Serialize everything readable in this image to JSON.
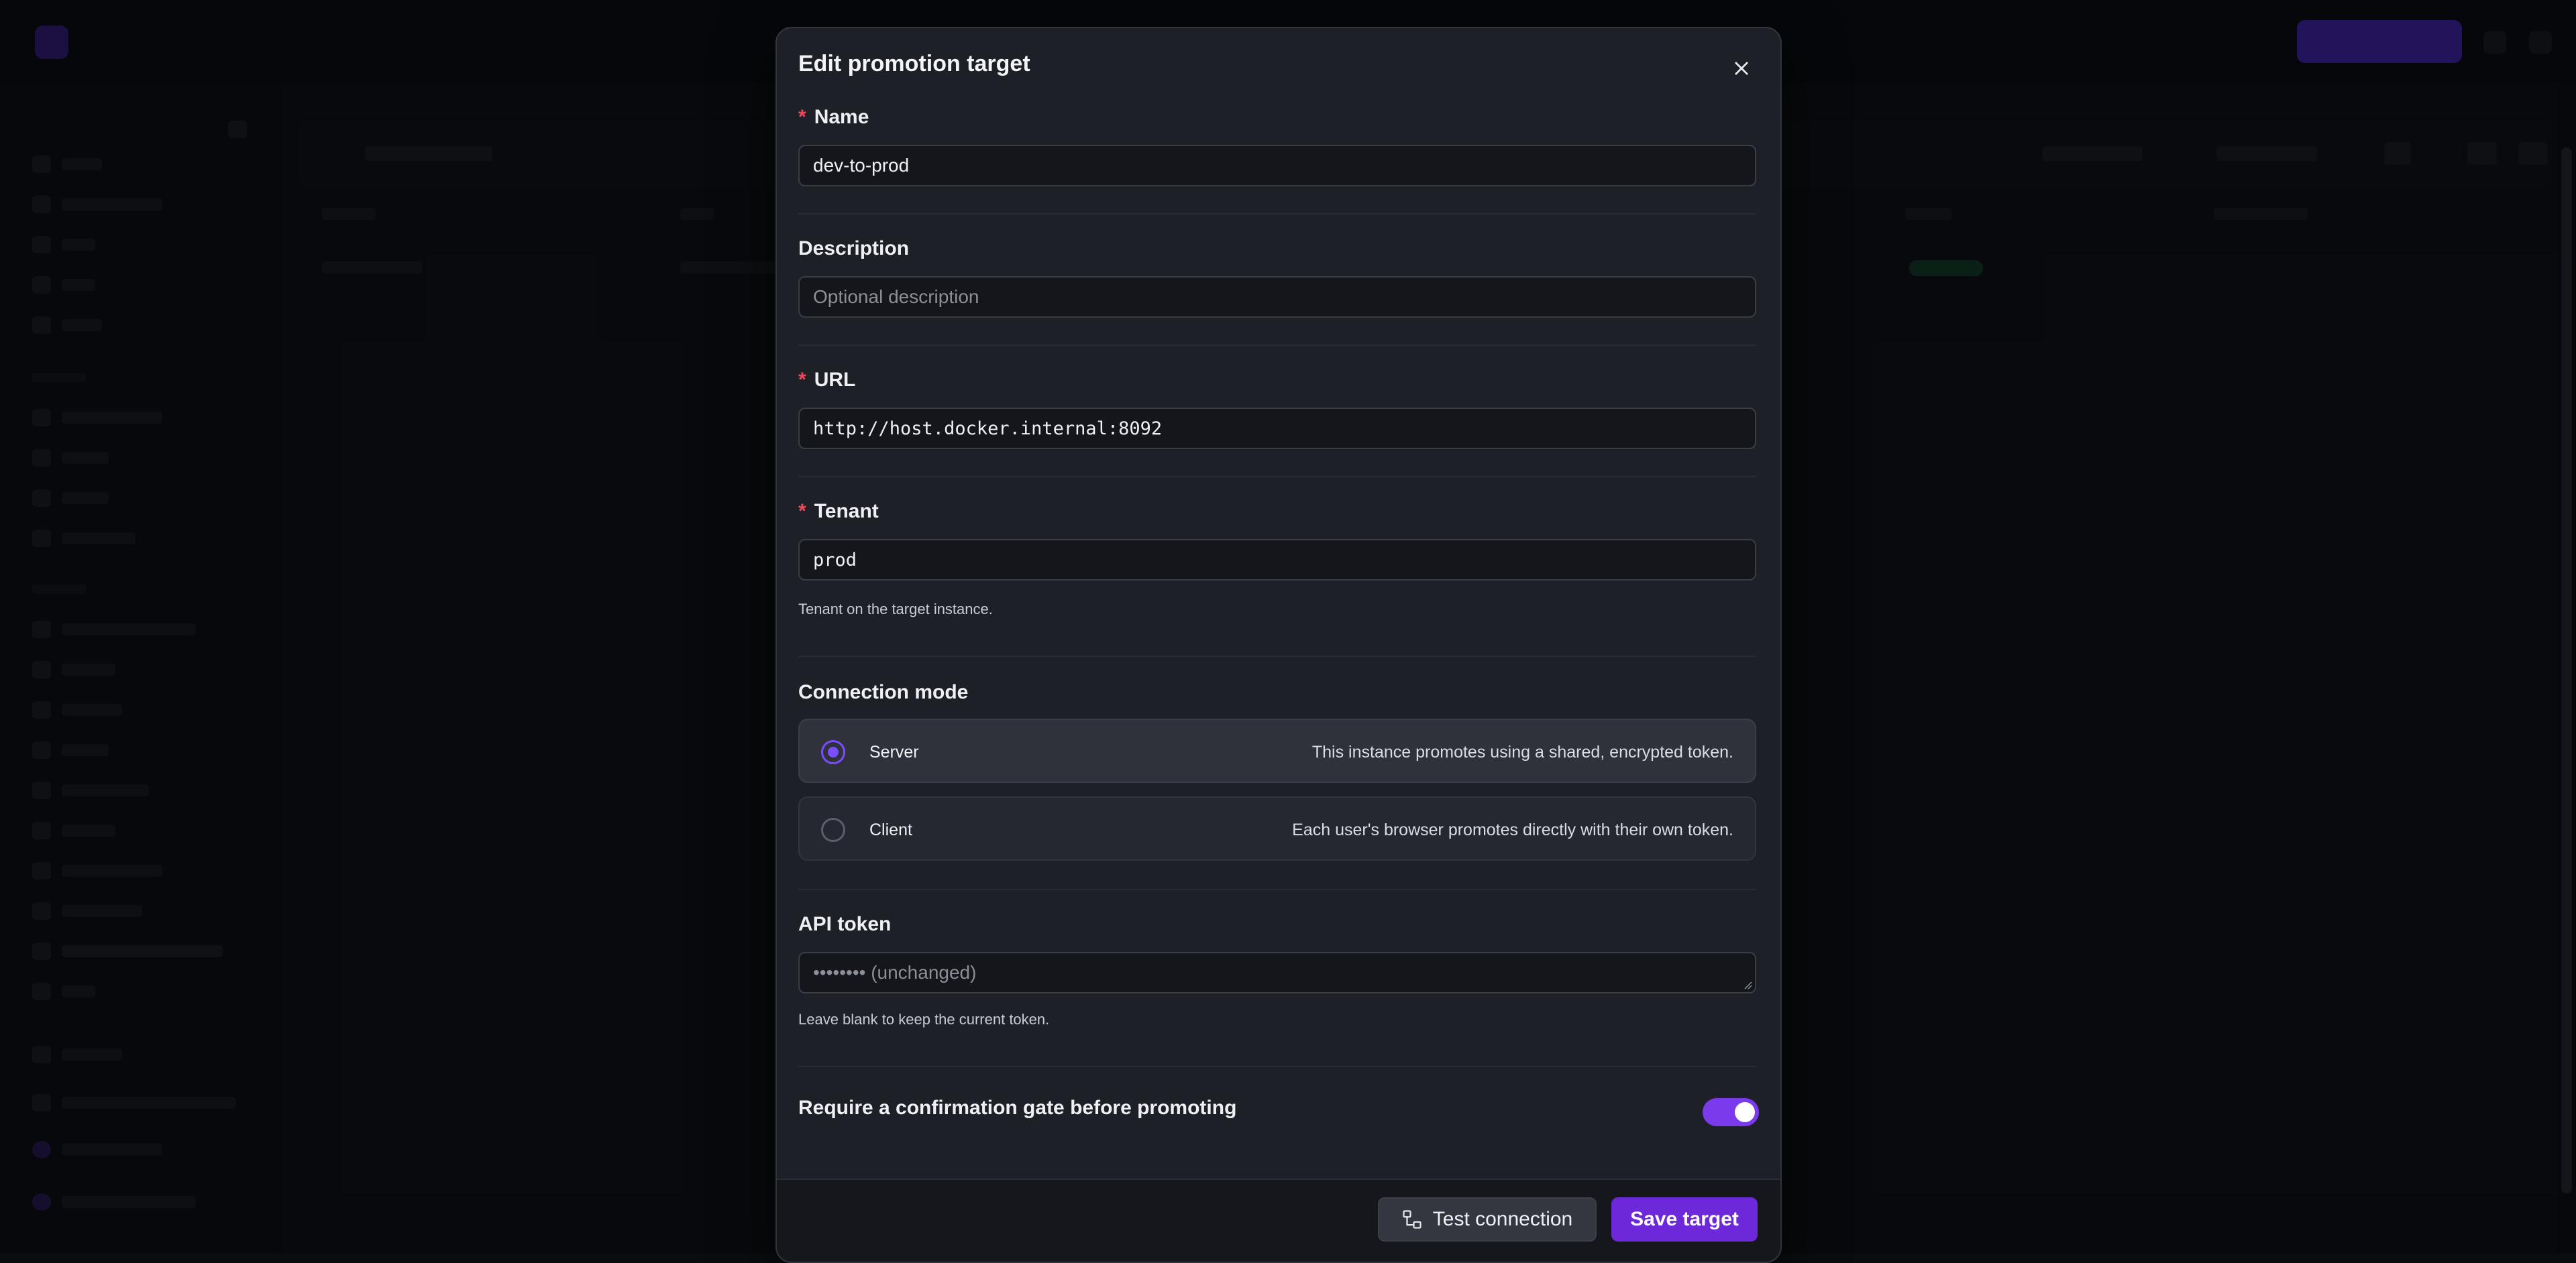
{
  "dialog": {
    "title": "Edit promotion target",
    "close_icon": "close-icon"
  },
  "fields": {
    "name": {
      "label": "Name",
      "required_mark": "*",
      "value": "dev-to-prod"
    },
    "description": {
      "label": "Description",
      "value": "",
      "placeholder": "Optional description"
    },
    "url": {
      "label": "URL",
      "required_mark": "*",
      "value": "http://host.docker.internal:8092"
    },
    "tenant": {
      "label": "Tenant",
      "required_mark": "*",
      "value": "prod",
      "help": "Tenant on the target instance."
    }
  },
  "connection_mode": {
    "label": "Connection mode",
    "options": [
      {
        "title": "Server",
        "description": "This instance promotes using a shared, encrypted token.",
        "selected": true
      },
      {
        "title": "Client",
        "description": "Each user's browser promotes directly with their own token.",
        "selected": false
      }
    ]
  },
  "api_token": {
    "label": "API token",
    "placeholder": "•••••••• (unchanged)",
    "help": "Leave blank to keep the current token."
  },
  "confirmation_gate": {
    "label": "Require a confirmation gate before promoting",
    "enabled": true,
    "accent_color": "#7c3aed"
  },
  "footer": {
    "test_label": "Test connection",
    "test_icon": "network-icon",
    "save_label": "Save target"
  },
  "colors": {
    "accent": "#7c4dff",
    "required": "#ef4a5a",
    "save_button": "#6d28d9"
  }
}
